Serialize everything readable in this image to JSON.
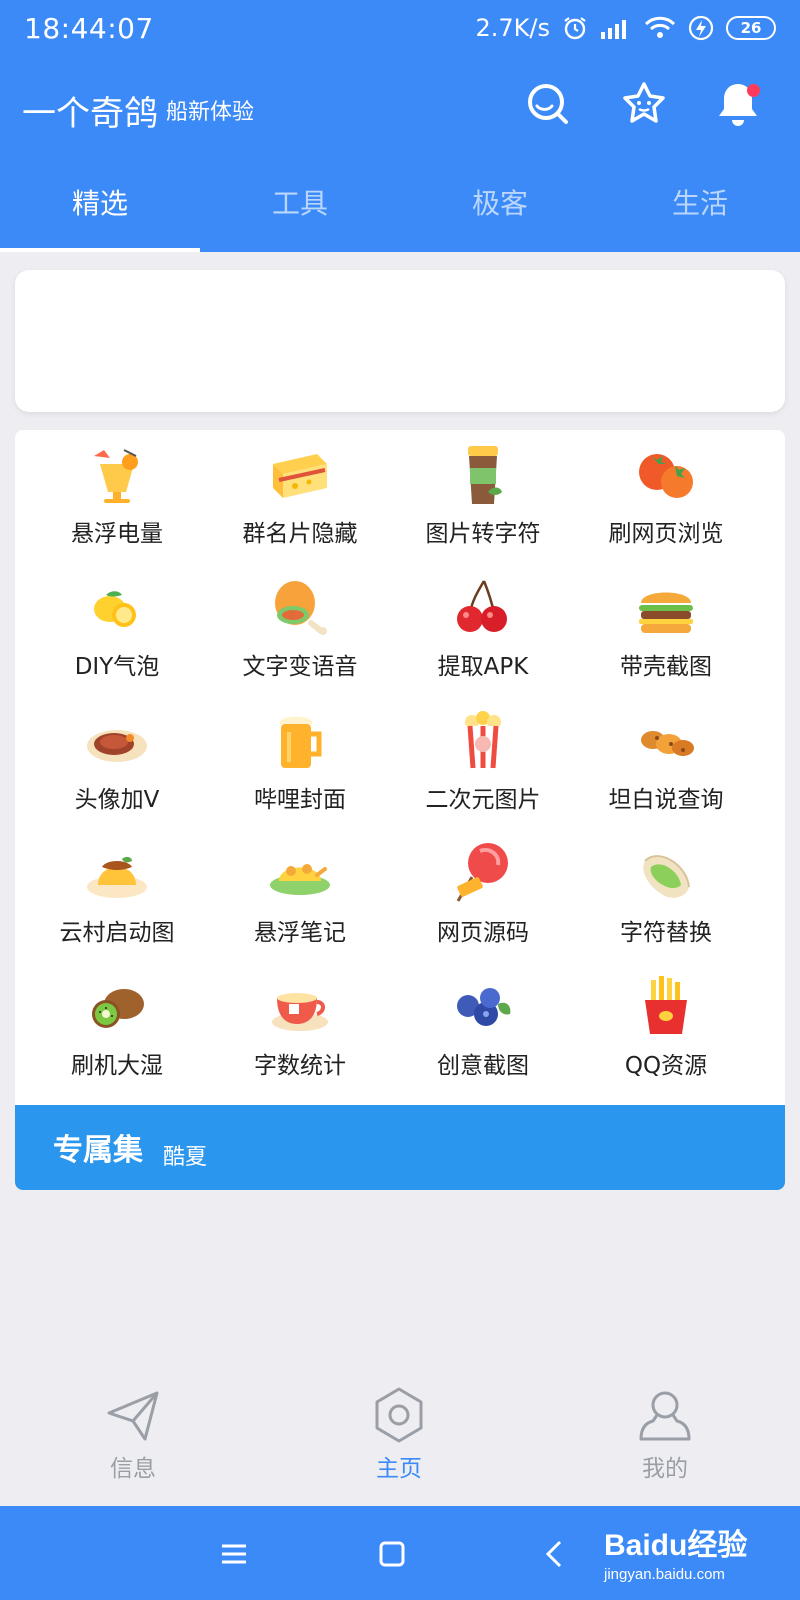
{
  "status_bar": {
    "time": "18:44:07",
    "net_speed": "2.7K/s",
    "battery": "26"
  },
  "app_bar": {
    "title": "一个奇鸽",
    "subtitle": "船新体验"
  },
  "icons": {
    "search": "search-icon",
    "favorite": "star-face-icon",
    "notifications": "bell-icon"
  },
  "tabs": [
    {
      "label": "精选",
      "active": true
    },
    {
      "label": "工具"
    },
    {
      "label": "极客"
    },
    {
      "label": "生活"
    }
  ],
  "grid": [
    {
      "label": "悬浮电量",
      "icon": "juice-icon"
    },
    {
      "label": "群名片隐藏",
      "icon": "sandwich-icon"
    },
    {
      "label": "图片转字符",
      "icon": "coffee-cup-icon"
    },
    {
      "label": "刷网页浏览",
      "icon": "tomato-icon"
    },
    {
      "label": "DIY气泡",
      "icon": "lemon-icon"
    },
    {
      "label": "文字变语音",
      "icon": "drumstick-icon"
    },
    {
      "label": "提取APK",
      "icon": "cherry-icon"
    },
    {
      "label": "带壳截图",
      "icon": "burger-icon"
    },
    {
      "label": "头像加V",
      "icon": "steak-icon"
    },
    {
      "label": "哔哩封面",
      "icon": "beer-icon"
    },
    {
      "label": "二次元图片",
      "icon": "popcorn-icon"
    },
    {
      "label": "坦白说查询",
      "icon": "peanut-icon"
    },
    {
      "label": "云村启动图",
      "icon": "pudding-icon"
    },
    {
      "label": "悬浮笔记",
      "icon": "roast-dish-icon"
    },
    {
      "label": "网页源码",
      "icon": "lollipop-icon"
    },
    {
      "label": "字符替换",
      "icon": "pistachio-icon"
    },
    {
      "label": "刷机大湿",
      "icon": "kiwi-icon"
    },
    {
      "label": "字数统计",
      "icon": "tea-cup-icon"
    },
    {
      "label": "创意截图",
      "icon": "blueberry-icon"
    },
    {
      "label": "QQ资源",
      "icon": "fries-icon"
    }
  ],
  "collection_bar": {
    "title": "专属集",
    "subtitle": "酷夏"
  },
  "bottom_nav": [
    {
      "label": "信息",
      "icon": "paper-plane-icon"
    },
    {
      "label": "主页",
      "icon": "hexagon-home-icon",
      "active": true
    },
    {
      "label": "我的",
      "icon": "user-icon"
    }
  ],
  "watermark": {
    "brand": "Baidu经验",
    "url": "jingyan.baidu.com"
  },
  "colors": {
    "primary": "#3b8af7",
    "accent_bar": "#2b96ee",
    "badge": "#ff3b5c"
  }
}
